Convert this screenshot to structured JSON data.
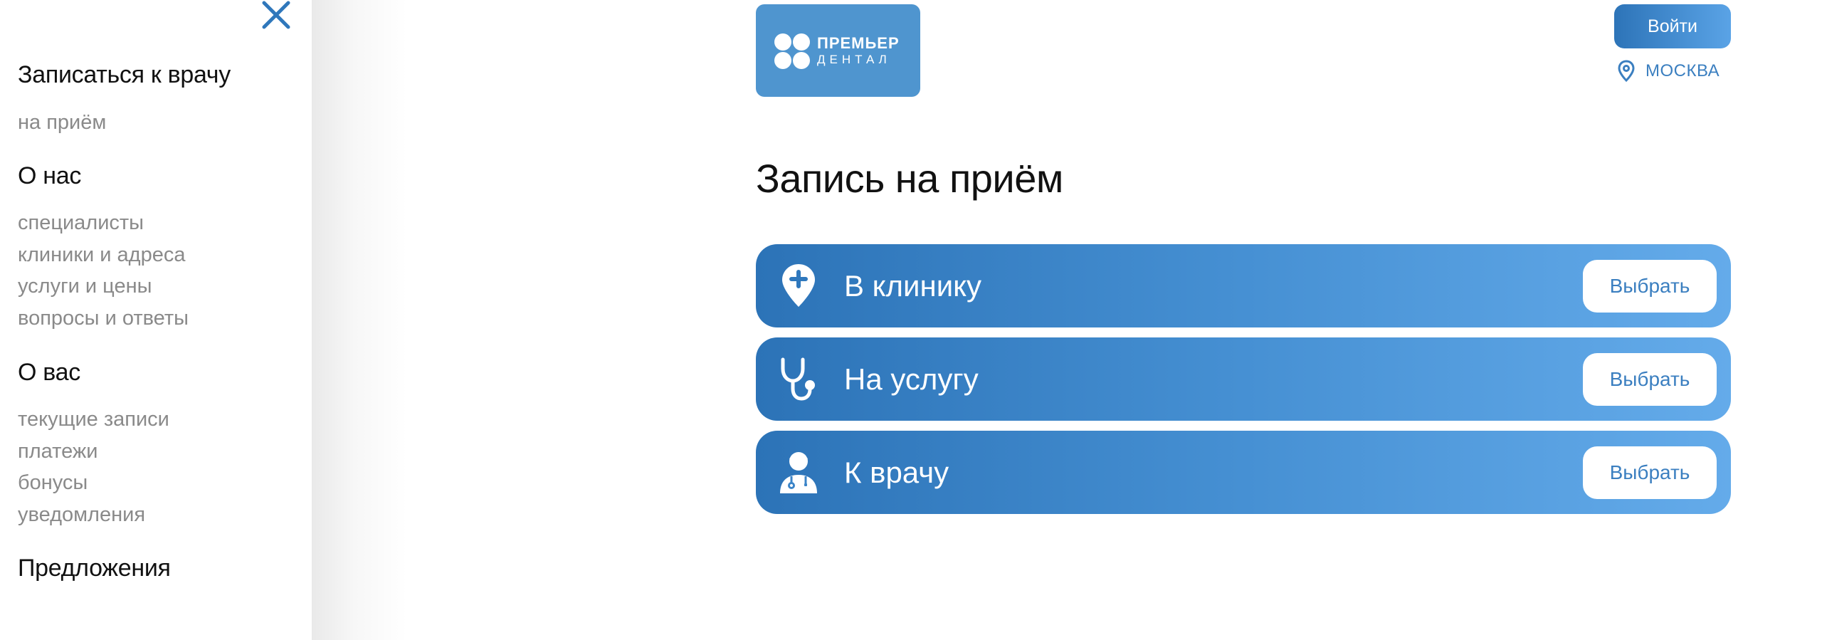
{
  "sidebar": {
    "sections": [
      {
        "heading": "Записаться к врачу",
        "items": [
          "на приём"
        ]
      },
      {
        "heading": "О нас",
        "items": [
          "специалисты",
          "клиники и адреса",
          "услуги и цены",
          "вопросы и ответы"
        ]
      },
      {
        "heading": "О вас",
        "items": [
          "текущие записи",
          "платежи",
          "бонусы",
          "уведомления"
        ]
      },
      {
        "heading": "Предложения",
        "items": []
      }
    ]
  },
  "header": {
    "logo": {
      "line1": "ПРЕМЬЕР",
      "line2": "ДЕНТАЛ"
    },
    "login_label": "Войти",
    "city": "МОСКВА"
  },
  "main": {
    "title": "Запись на приём",
    "options": [
      {
        "label": "В клинику",
        "icon": "location-plus-icon",
        "button": "Выбрать"
      },
      {
        "label": "На услугу",
        "icon": "stethoscope-icon",
        "button": "Выбрать"
      },
      {
        "label": "К врачу",
        "icon": "doctor-icon",
        "button": "Выбрать"
      }
    ]
  },
  "colors": {
    "accent": "#2d74b8",
    "accent_light": "#64abea",
    "logo_bg": "#4f95cf",
    "link_gray": "#8a8a8a"
  }
}
